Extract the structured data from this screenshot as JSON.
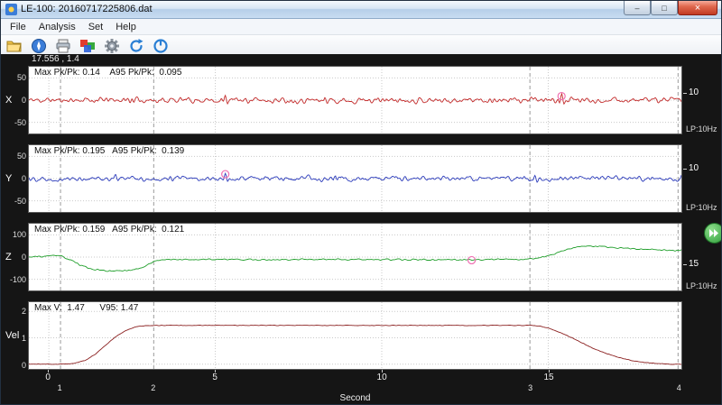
{
  "window": {
    "title": "LE-100: 20160717225806.dat",
    "buttons": {
      "minimize": "–",
      "maximize": "□",
      "close": "×"
    }
  },
  "menu": {
    "items": [
      "File",
      "Analysis",
      "Set",
      "Help"
    ]
  },
  "toolbar": {
    "icons": [
      {
        "name": "open-file-icon"
      },
      {
        "name": "compass-view-icon"
      },
      {
        "name": "print-icon"
      },
      {
        "name": "color-display-icon"
      },
      {
        "name": "settings-gear-icon"
      },
      {
        "name": "refresh-icon"
      },
      {
        "name": "power-icon"
      }
    ]
  },
  "readout": {
    "cursor_position": "17.556 , 1.4"
  },
  "chart_data": {
    "type": "line",
    "xlabel": "Second",
    "x_range": [
      -0.6,
      19.0
    ],
    "xticks": [
      0,
      5,
      10,
      15
    ],
    "grid": "dotted",
    "cursors": [
      {
        "label": "1",
        "x": 0.35
      },
      {
        "label": "2",
        "x": 3.15
      },
      {
        "label": "3",
        "x": 14.45
      },
      {
        "label": "4",
        "x": 18.9
      }
    ],
    "channels": [
      {
        "label": "X",
        "color": "#c32a2a",
        "ylim": [
          -75,
          75
        ],
        "yticks": [
          50,
          0,
          -50
        ],
        "stats": "Max Pk/Pk: 0.14    A95 Pk/Pk:  0.095",
        "right_value": "10",
        "right_value_frac": 0.4,
        "filter_label": "LP:10Hz",
        "noise_amp": 3.5,
        "seed": 11,
        "spikes": [
          {
            "x": 2.5,
            "a": 5
          },
          {
            "x": 5.3,
            "a": 7
          },
          {
            "x": 8.3,
            "a": 5
          },
          {
            "x": 15.4,
            "a": 13
          }
        ],
        "marker": {
          "x": 15.4,
          "y": 9
        }
      },
      {
        "label": "Y",
        "color": "#2b3bbb",
        "ylim": [
          -75,
          75
        ],
        "yticks": [
          50,
          0,
          -50
        ],
        "stats": "Max Pk/Pk: 0.195   A95 Pk/Pk:  0.139",
        "right_value": "10",
        "right_value_frac": 0.36,
        "filter_label": "LP:10Hz",
        "noise_amp": 3.2,
        "seed": 22,
        "spikes": [
          {
            "x": 2.0,
            "a": 5
          },
          {
            "x": 5.3,
            "a": 11
          },
          {
            "x": 8.6,
            "a": 5
          },
          {
            "x": 14.6,
            "a": 6
          }
        ],
        "marker": {
          "x": 5.3,
          "y": 10
        }
      },
      {
        "label": "Z",
        "color": "#1f9e2a",
        "ylim": [
          -150,
          150
        ],
        "yticks": [
          100,
          0,
          -100
        ],
        "stats": "Max Pk/Pk: 0.159   A95 Pk/Pk:  0.121",
        "right_value": "15",
        "right_value_frac": 0.6,
        "filter_label": "LP:10Hz",
        "noise_amp": 1.8,
        "seed": 33,
        "base": [
          [
            -0.6,
            0
          ],
          [
            0.0,
            4
          ],
          [
            0.25,
            8
          ],
          [
            0.45,
            0
          ],
          [
            0.7,
            -18
          ],
          [
            1.0,
            -40
          ],
          [
            1.3,
            -55
          ],
          [
            1.7,
            -62
          ],
          [
            2.1,
            -62
          ],
          [
            2.5,
            -58
          ],
          [
            2.8,
            -48
          ],
          [
            3.0,
            -32
          ],
          [
            3.2,
            -16
          ],
          [
            3.5,
            -11
          ],
          [
            5,
            -11
          ],
          [
            7,
            -12
          ],
          [
            9,
            -11
          ],
          [
            11,
            -12
          ],
          [
            13,
            -11
          ],
          [
            14.3,
            -10
          ],
          [
            14.7,
            -4
          ],
          [
            15.0,
            6
          ],
          [
            15.3,
            20
          ],
          [
            15.6,
            35
          ],
          [
            15.9,
            45
          ],
          [
            16.2,
            50
          ],
          [
            16.6,
            48
          ],
          [
            17.0,
            43
          ],
          [
            17.5,
            38
          ],
          [
            18.0,
            34
          ],
          [
            18.5,
            31
          ],
          [
            19.0,
            30
          ]
        ],
        "marker": {
          "x": 12.7,
          "y": -14
        }
      },
      {
        "label": "Vel",
        "color": "#8b2020",
        "ylim": [
          -0.18,
          2.35
        ],
        "yticks": [
          2,
          1,
          0
        ],
        "stats": "Max V:  1.47      V95: 1.47",
        "noise_amp": 0.006,
        "seed": 44,
        "base": [
          [
            -0.6,
            0
          ],
          [
            0.45,
            0
          ],
          [
            0.8,
            0.04
          ],
          [
            1.1,
            0.15
          ],
          [
            1.4,
            0.38
          ],
          [
            1.7,
            0.72
          ],
          [
            2.0,
            1.03
          ],
          [
            2.3,
            1.27
          ],
          [
            2.6,
            1.41
          ],
          [
            2.9,
            1.46
          ],
          [
            3.2,
            1.47
          ],
          [
            14.5,
            1.47
          ],
          [
            14.8,
            1.43
          ],
          [
            15.1,
            1.33
          ],
          [
            15.5,
            1.13
          ],
          [
            15.9,
            0.88
          ],
          [
            16.3,
            0.63
          ],
          [
            16.7,
            0.42
          ],
          [
            17.1,
            0.26
          ],
          [
            17.5,
            0.14
          ],
          [
            17.9,
            0.06
          ],
          [
            18.3,
            0.02
          ],
          [
            18.6,
            0
          ],
          [
            19.0,
            0
          ]
        ]
      }
    ]
  }
}
